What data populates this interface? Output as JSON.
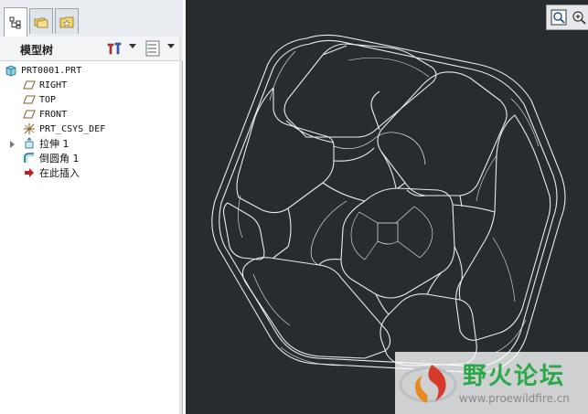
{
  "tabs": [
    {
      "name": "model-tree-tab",
      "icon": "tree-icon",
      "active": true
    },
    {
      "name": "folder-browser-tab",
      "icon": "folder-icon",
      "active": false
    },
    {
      "name": "favorites-tab",
      "icon": "favorites-icon",
      "active": false
    }
  ],
  "model_tree": {
    "title": "模型树",
    "settings_icon": "settings-icon",
    "show_icon": "show-list-icon",
    "items": [
      {
        "label": "PRT0001.PRT",
        "icon": "part-icon",
        "level": 0
      },
      {
        "label": "RIGHT",
        "icon": "datum-plane-icon",
        "level": 1
      },
      {
        "label": "TOP",
        "icon": "datum-plane-icon",
        "level": 1
      },
      {
        "label": "FRONT",
        "icon": "datum-plane-icon",
        "level": 1
      },
      {
        "label": "PRT_CSYS_DEF",
        "icon": "csys-icon",
        "level": 1
      },
      {
        "label": "拉伸 1",
        "icon": "extrude-icon",
        "level": 1,
        "expandable": true
      },
      {
        "label": "倒圆角 1",
        "icon": "round-icon",
        "level": 1
      },
      {
        "label": "在此插入",
        "icon": "insert-here-icon",
        "level": 1
      }
    ]
  },
  "viewport": {
    "background": "#282c2e",
    "tools": [
      {
        "icon": "zoom-icon"
      },
      {
        "icon": "zoom-in-icon"
      }
    ]
  },
  "watermark": {
    "text": "野火论坛",
    "url": "www.proewildfire.cn"
  }
}
